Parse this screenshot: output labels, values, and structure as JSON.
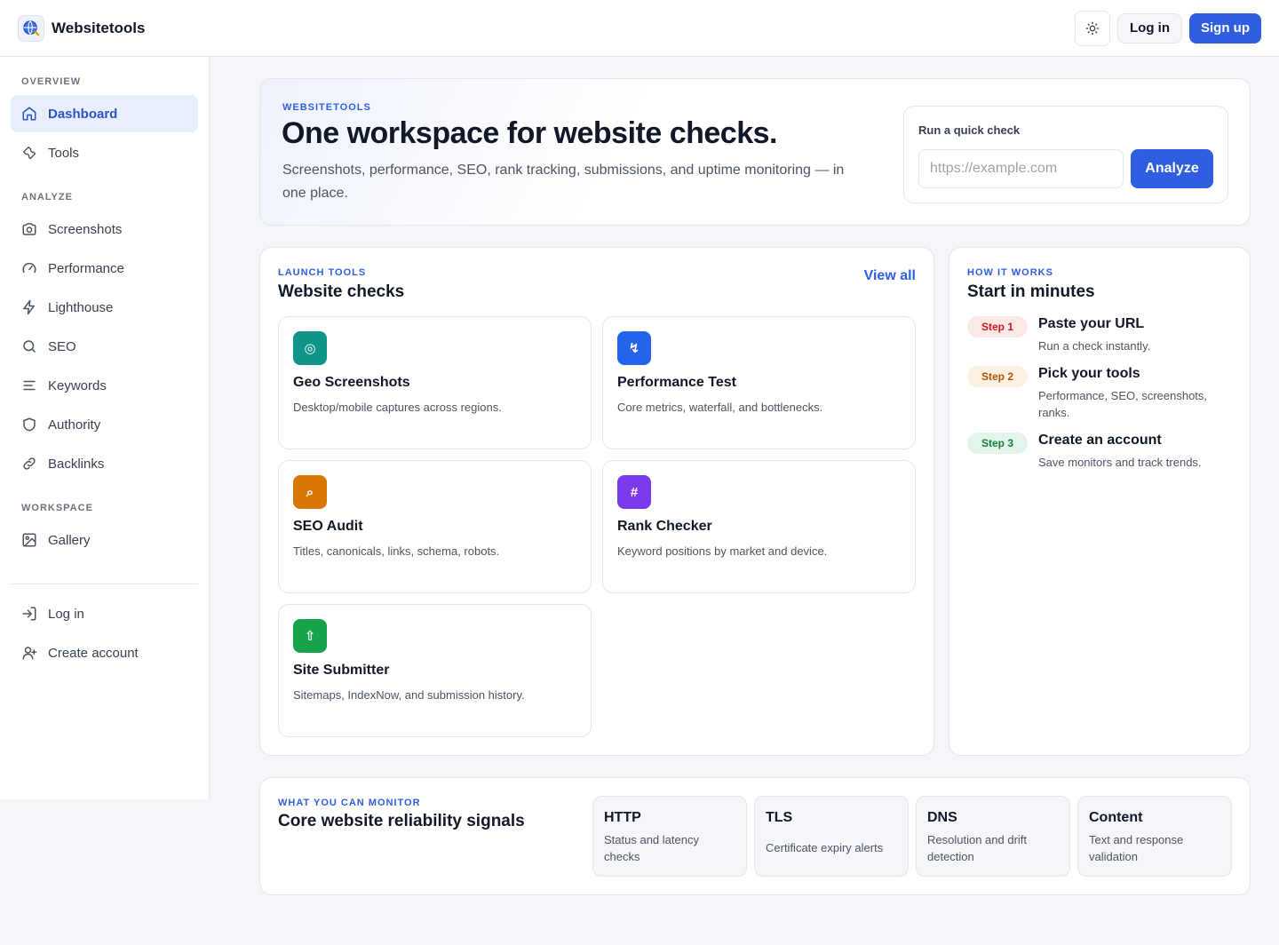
{
  "header": {
    "brand": "Websitetools",
    "login_label": "Log in",
    "signup_label": "Sign up"
  },
  "sidebar": {
    "sections": {
      "overview": "OVERVIEW",
      "analyze": "ANALYZE",
      "workspace": "WORKSPACE"
    },
    "items": {
      "dashboard": "Dashboard",
      "tools": "Tools",
      "screenshots": "Screenshots",
      "performance": "Performance",
      "lighthouse": "Lighthouse",
      "seo": "SEO",
      "keywords": "Keywords",
      "authority": "Authority",
      "backlinks": "Backlinks",
      "gallery": "Gallery",
      "login": "Log in",
      "create_account": "Create account"
    }
  },
  "hero": {
    "eyebrow": "WEBSITETOOLS",
    "title": "One workspace for website checks.",
    "description": "Screenshots, performance, SEO, rank tracking, submissions, and uptime monitoring — in one place.",
    "quick_check": {
      "label": "Run a quick check",
      "placeholder": "https://example.com",
      "value": "",
      "button": "Analyze"
    }
  },
  "tools": {
    "eyebrow": "LAUNCH TOOLS",
    "title": "Website checks",
    "view_all": "View all",
    "items": [
      {
        "name": "Geo Screenshots",
        "desc": "Desktop/mobile captures across regions.",
        "glyph": "◎",
        "color": "#0f9488",
        "icon": "target-icon"
      },
      {
        "name": "Performance Test",
        "desc": "Core metrics, waterfall, and bottlenecks.",
        "glyph": "↯",
        "color": "#2563eb",
        "icon": "lightning-icon"
      },
      {
        "name": "SEO Audit",
        "desc": "Titles, canonicals, links, schema, robots.",
        "glyph": "⌕",
        "color": "#d97706",
        "icon": "search-icon"
      },
      {
        "name": "Rank Checker",
        "desc": "Keyword positions by market and device.",
        "glyph": "#",
        "color": "#7c3aed",
        "icon": "hash-icon"
      },
      {
        "name": "Site Submitter",
        "desc": "Sitemaps, IndexNow, and submission history.",
        "glyph": "⇧",
        "color": "#16a34a",
        "icon": "upload-icon"
      }
    ]
  },
  "how": {
    "eyebrow": "HOW IT WORKS",
    "title": "Start in minutes",
    "steps": [
      {
        "badge": "Step 1",
        "title": "Paste your URL",
        "desc": "Run a check instantly.",
        "bg": "#fde8e8",
        "fg": "#c81e1e"
      },
      {
        "badge": "Step 2",
        "title": "Pick your tools",
        "desc": "Performance, SEO, screenshots, ranks.",
        "bg": "#fdf1e1",
        "fg": "#b45309"
      },
      {
        "badge": "Step 3",
        "title": "Create an account",
        "desc": "Save monitors and track trends.",
        "bg": "#e3f5ea",
        "fg": "#15803d"
      }
    ]
  },
  "monitor": {
    "eyebrow": "WHAT YOU CAN MONITOR",
    "title": "Core website reliability signals",
    "signals": [
      {
        "name": "HTTP",
        "desc": "Status and latency checks"
      },
      {
        "name": "TLS",
        "desc": "Certificate expiry alerts"
      },
      {
        "name": "DNS",
        "desc": "Resolution and drift detection"
      },
      {
        "name": "Content",
        "desc": "Text and response validation"
      }
    ]
  }
}
